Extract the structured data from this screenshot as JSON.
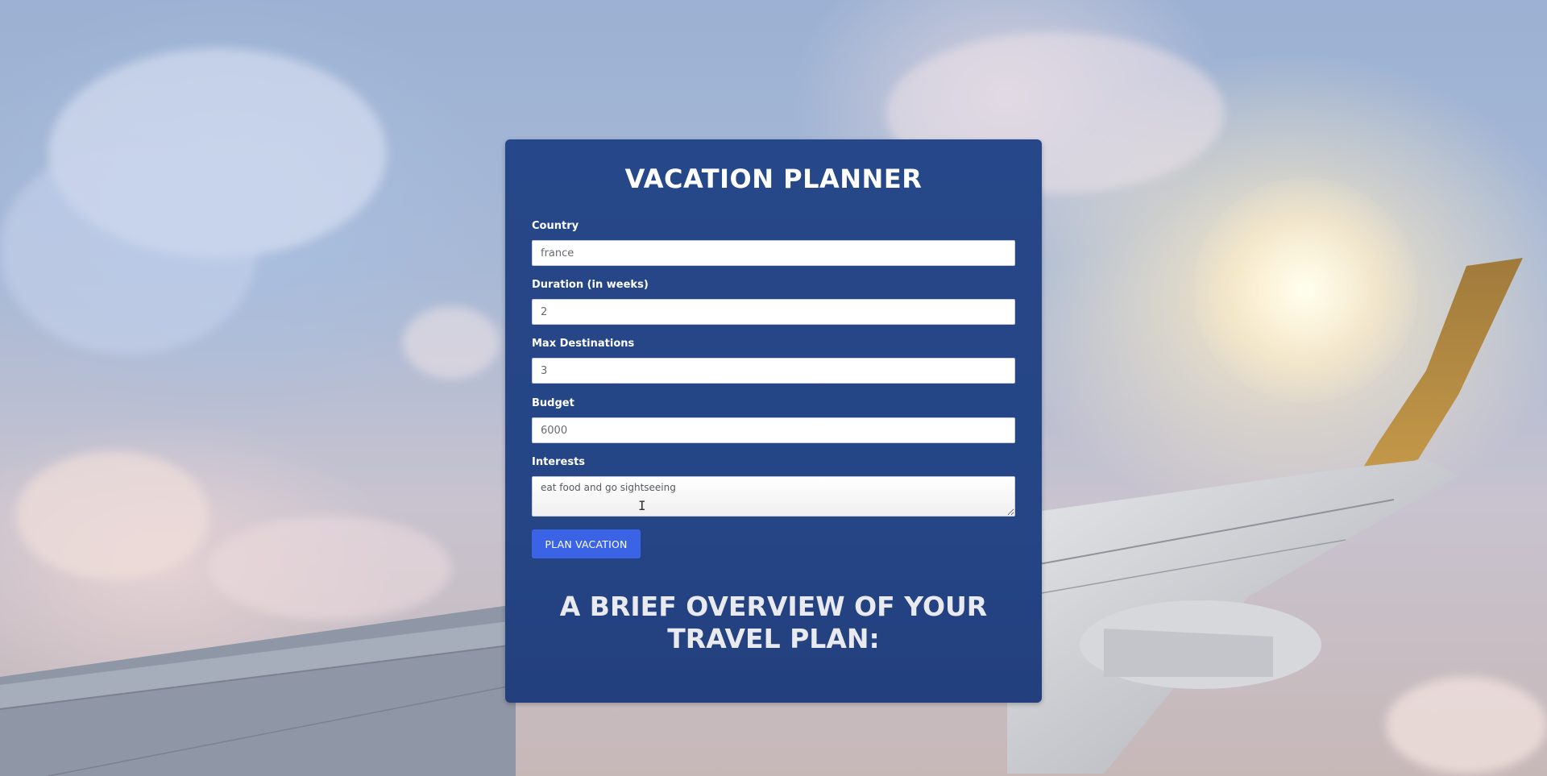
{
  "app": {
    "title": "VACATION PLANNER"
  },
  "form": {
    "country": {
      "label": "Country",
      "value": "france"
    },
    "duration": {
      "label": "Duration (in weeks)",
      "value": "2"
    },
    "max_destinations": {
      "label": "Max Destinations",
      "value": "3"
    },
    "budget": {
      "label": "Budget",
      "value": "6000"
    },
    "interests": {
      "label": "Interests",
      "value": "eat food and go sightseeing"
    },
    "submit_label": "PLAN VACATION"
  },
  "overview": {
    "heading": "A BRIEF OVERVIEW OF YOUR TRAVEL PLAN:"
  },
  "colors": {
    "card_bg": "#264789",
    "button_bg": "#3a63e6"
  },
  "icons": {
    "text_cursor": "ibeam-cursor-icon",
    "resize_handle": "resize-handle-icon"
  }
}
